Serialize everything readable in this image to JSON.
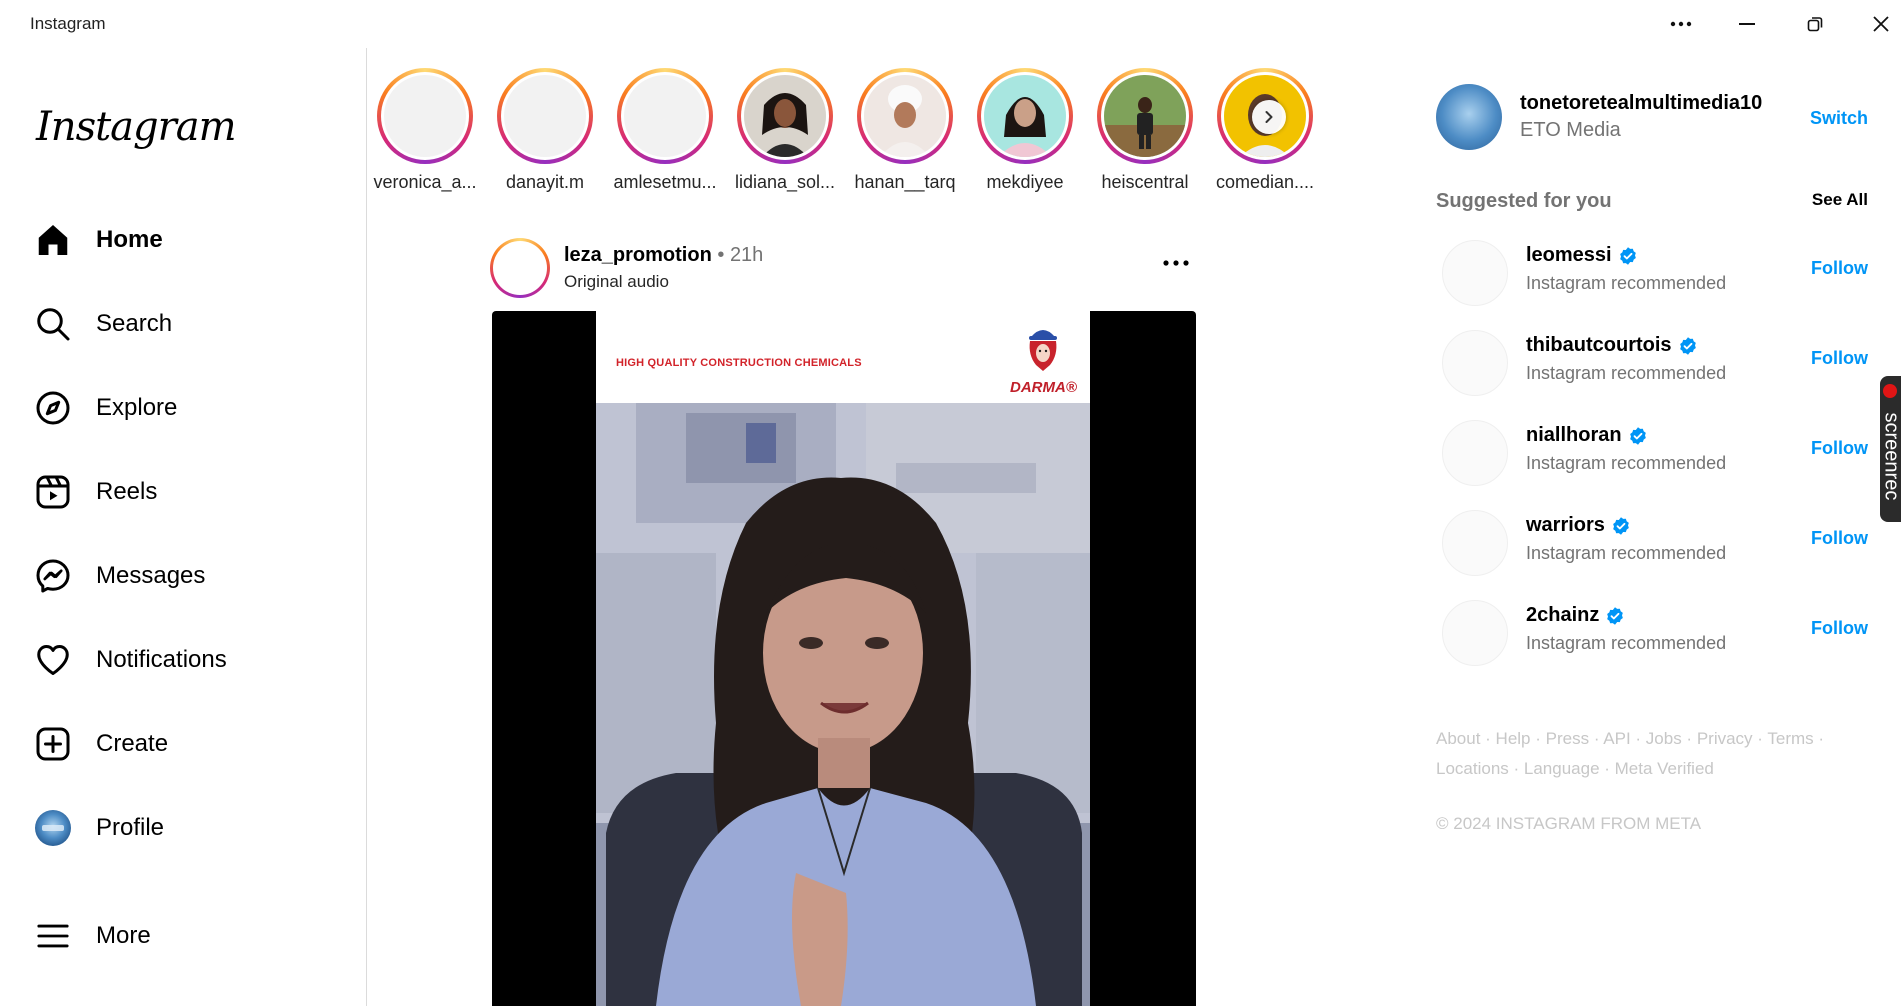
{
  "window": {
    "title": "Instagram",
    "controls": [
      "more-icon",
      "minimize-icon",
      "restore-icon",
      "close-icon"
    ]
  },
  "sidebar": {
    "logo": "Instagram",
    "items": [
      {
        "label": "Home",
        "icon": "home-icon",
        "active": true
      },
      {
        "label": "Search",
        "icon": "search-icon"
      },
      {
        "label": "Explore",
        "icon": "compass-icon"
      },
      {
        "label": "Reels",
        "icon": "reels-icon"
      },
      {
        "label": "Messages",
        "icon": "messenger-icon"
      },
      {
        "label": "Notifications",
        "icon": "heart-icon"
      },
      {
        "label": "Create",
        "icon": "plus-square-icon"
      },
      {
        "label": "Profile",
        "icon": "profile-avatar"
      },
      {
        "label": "More",
        "icon": "menu-icon"
      }
    ]
  },
  "stories": [
    {
      "name": "veronica_a..."
    },
    {
      "name": "danayit.m"
    },
    {
      "name": "amlesetmu..."
    },
    {
      "name": "lidiana_sol..."
    },
    {
      "name": "hanan__tarq"
    },
    {
      "name": "mekdiyee"
    },
    {
      "name": "heiscentral"
    },
    {
      "name": "comedian...."
    }
  ],
  "post": {
    "username": "leza_promotion",
    "separator": "•",
    "time": "21h",
    "audio": "Original audio",
    "banner_text": "HIGH QUALITY CONSTRUCTION CHEMICALS",
    "brand": "DARMA®"
  },
  "account": {
    "username": "tonetoretealmultimedia10",
    "full_name": "ETO Media",
    "switch_label": "Switch"
  },
  "suggestions": {
    "heading": "Suggested for you",
    "see_all": "See All",
    "follow_label": "Follow",
    "items": [
      {
        "username": "leomessi",
        "reason": "Instagram recommended"
      },
      {
        "username": "thibautcourtois",
        "reason": "Instagram recommended"
      },
      {
        "username": "niallhoran",
        "reason": "Instagram recommended"
      },
      {
        "username": "warriors",
        "reason": "Instagram recommended"
      },
      {
        "username": "2chainz",
        "reason": "Instagram recommended"
      }
    ]
  },
  "footer": {
    "links": [
      "About",
      "Help",
      "Press",
      "API",
      "Jobs",
      "Privacy",
      "Terms",
      "Locations",
      "Language",
      "Meta Verified"
    ],
    "copyright": "© 2024 INSTAGRAM FROM META"
  },
  "overlay": {
    "screenrec_label": "screenrec"
  },
  "colors": {
    "accent_blue": "#0095f6",
    "verified": "#0095f6",
    "muted_text": "#737373",
    "border": "#dbdbdb"
  }
}
